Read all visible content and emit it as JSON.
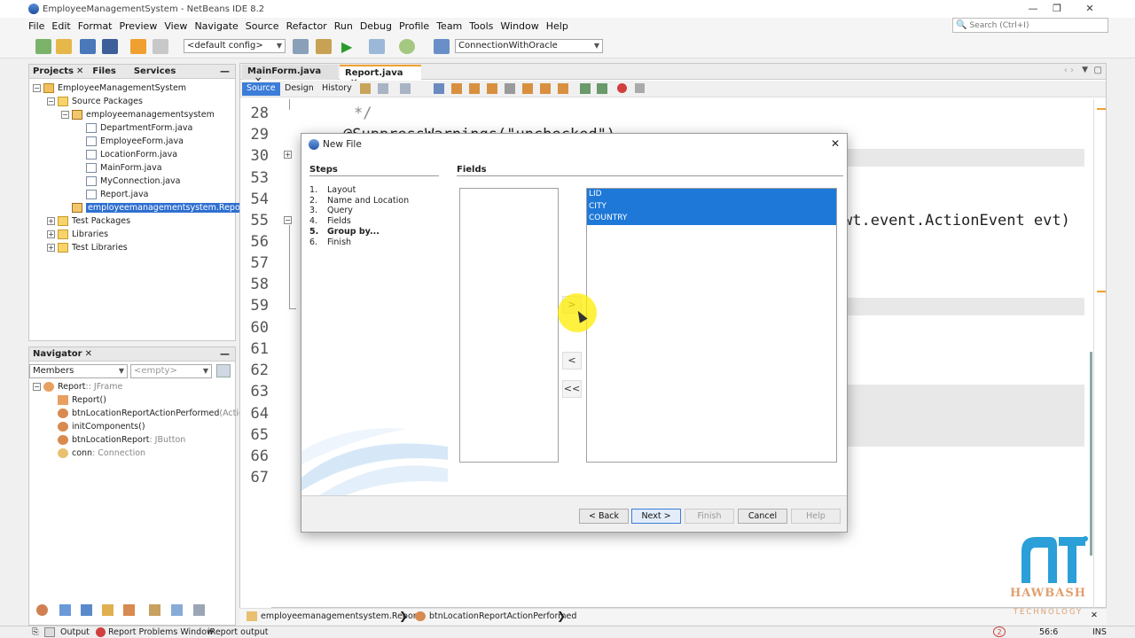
{
  "window": {
    "title": "EmployeeManagementSystem - NetBeans IDE 8.2"
  },
  "menu": [
    "File",
    "Edit",
    "Format",
    "Preview",
    "View",
    "Navigate",
    "Source",
    "Refactor",
    "Run",
    "Debug",
    "Profile",
    "Team",
    "Tools",
    "Window",
    "Help"
  ],
  "search": {
    "placeholder": "Search (Ctrl+I)"
  },
  "toolbar": {
    "config": "<default config>",
    "connection": "ConnectionWithOracle"
  },
  "projects_panel": {
    "tabs": [
      "Projects",
      "Files",
      "Services"
    ],
    "tree": [
      {
        "label": "EmployeeManagementSystem",
        "level": 0,
        "icon": "project-icon",
        "expander": "−"
      },
      {
        "label": "Source Packages",
        "level": 1,
        "icon": "folder-icon",
        "expander": "−"
      },
      {
        "label": "employeemanagementsystem",
        "level": 2,
        "icon": "package-icon",
        "expander": "−"
      },
      {
        "label": "DepartmentForm.java",
        "level": 3,
        "icon": "java-file-icon",
        "expander": ""
      },
      {
        "label": "EmployeeForm.java",
        "level": 3,
        "icon": "java-file-icon",
        "expander": ""
      },
      {
        "label": "LocationForm.java",
        "level": 3,
        "icon": "java-file-icon",
        "expander": ""
      },
      {
        "label": "MainForm.java",
        "level": 3,
        "icon": "java-file-icon",
        "expander": ""
      },
      {
        "label": "MyConnection.java",
        "level": 3,
        "icon": "java-file-icon",
        "expander": ""
      },
      {
        "label": "Report.java",
        "level": 3,
        "icon": "java-file-icon",
        "expander": ""
      },
      {
        "label": "employeemanagementsystem.Report",
        "level": 2,
        "icon": "package-icon",
        "expander": "",
        "selected": true
      },
      {
        "label": "Test Packages",
        "level": 1,
        "icon": "folder-icon",
        "expander": "+"
      },
      {
        "label": "Libraries",
        "level": 1,
        "icon": "folder-icon",
        "expander": "+"
      },
      {
        "label": "Test Libraries",
        "level": 1,
        "icon": "folder-icon",
        "expander": "+"
      }
    ]
  },
  "navigator": {
    "title": "Navigator",
    "filter": "Members",
    "filter2": "<empty>",
    "items": [
      {
        "name": "Report",
        "type": " :: JFrame",
        "level": 0
      },
      {
        "name": "Report()",
        "type": "",
        "level": 1
      },
      {
        "name": "btnLocationReportActionPerformed",
        "type": "(ActionEv",
        "level": 1
      },
      {
        "name": "initComponents()",
        "type": "",
        "level": 1
      },
      {
        "name": "btnLocationReport",
        "type": " : JButton",
        "level": 1
      },
      {
        "name": "conn",
        "type": " : Connection",
        "level": 1
      }
    ]
  },
  "editor": {
    "tabs": [
      "MainForm.java",
      "Report.java"
    ],
    "view_tabs": [
      "Source",
      "Design",
      "History"
    ],
    "line_numbers": [
      "28",
      "29",
      "30",
      "53",
      "54",
      "55",
      "56",
      "57",
      "58",
      "59",
      "60",
      "61",
      "62",
      "63",
      "64",
      "65",
      "66",
      "67"
    ],
    "code_comment": "*/",
    "code_annotation": "@SuppressWarnings(\"unchecked\")",
    "code_fragment": "wt.event.ActionEvent evt)"
  },
  "breadcrumbs": [
    "employeemanagementsystem.Report",
    "btnLocationReportActionPerformed"
  ],
  "dialog": {
    "title": "New File",
    "steps_header": "Steps",
    "fields_header": "Fields",
    "steps": [
      {
        "num": "1.",
        "label": "Layout",
        "current": false
      },
      {
        "num": "2.",
        "label": "Name and Location",
        "current": false
      },
      {
        "num": "3.",
        "label": "Query",
        "current": false
      },
      {
        "num": "4.",
        "label": "Fields",
        "current": false
      },
      {
        "num": "5.",
        "label": "Group by...",
        "current": true
      },
      {
        "num": "6.",
        "label": "Finish",
        "current": false
      }
    ],
    "selected_fields": [
      "LID",
      "CITY",
      "COUNTRY"
    ],
    "move_buttons": [
      ">",
      "<",
      "<<"
    ],
    "buttons": {
      "back": "< Back",
      "next": "Next >",
      "finish": "Finish",
      "cancel": "Cancel",
      "help": "Help"
    }
  },
  "status": {
    "output": "Output",
    "problems": "Report Problems Window",
    "ireport": "iReport output",
    "notifications": "2",
    "position": "56:6",
    "mode": "INS"
  },
  "watermark": {
    "brand": "HAWBASH",
    "sub": "TECHNOLOGY"
  }
}
